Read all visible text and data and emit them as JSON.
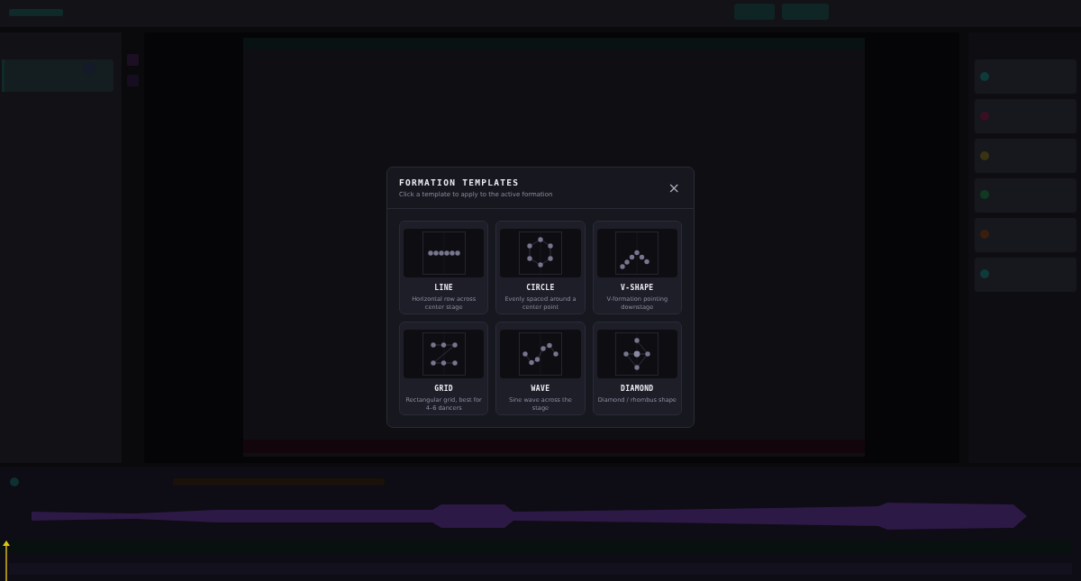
{
  "dialog": {
    "title": "FORMATION TEMPLATES",
    "subtitle": "Click a template to apply to the active formation",
    "close": "×"
  },
  "templates": [
    {
      "kind": "line",
      "name": "LINE",
      "description": "Horizontal row across center stage"
    },
    {
      "kind": "circle",
      "name": "CIRCLE",
      "description": "Evenly spaced around a center point"
    },
    {
      "kind": "v-shape",
      "name": "V-SHAPE",
      "description": "V-formation pointing downstage"
    },
    {
      "kind": "grid",
      "name": "GRID",
      "description": "Rectangular grid, best for 4–6 dancers"
    },
    {
      "kind": "wave",
      "name": "WAVE",
      "description": "Sine wave across the stage"
    },
    {
      "kind": "diamond",
      "name": "DIAMOND",
      "description": "Diamond / rhombus shape"
    }
  ]
}
